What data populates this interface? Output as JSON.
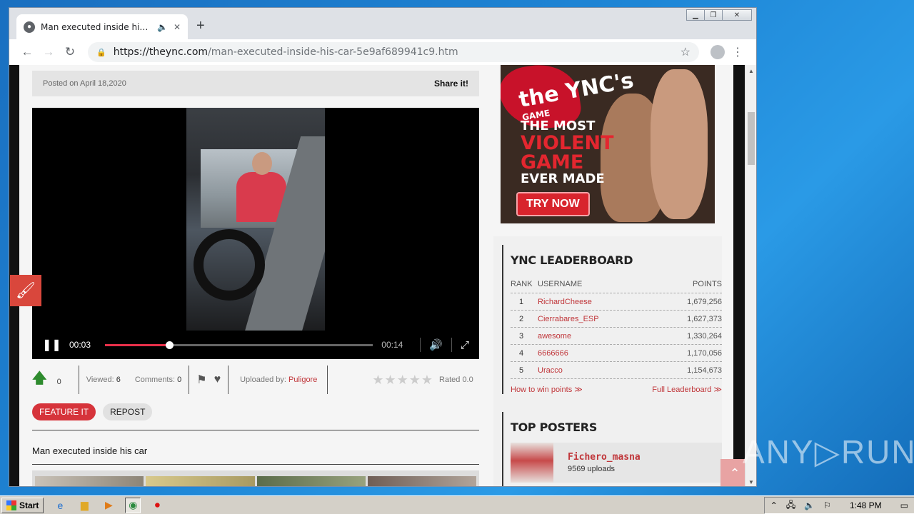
{
  "browser": {
    "tab_title": "Man executed inside his car | th",
    "url_host": "https://theync.com",
    "url_path": "/man-executed-inside-his-car-5e9af689941c9.htm"
  },
  "post": {
    "posted": "Posted on April 18,2020",
    "share": "Share it!"
  },
  "player": {
    "current_time": "00:03",
    "duration": "00:14",
    "progress": 0.23
  },
  "stats": {
    "upvotes": "0",
    "viewed_label": "Viewed:",
    "viewed": "6",
    "comments_label": "Comments:",
    "comments": "0",
    "uploaded_label": "Uploaded by:",
    "uploader": "Puligore",
    "rated": "Rated 0.0"
  },
  "buttons": {
    "feature": "FEATURE IT",
    "repost": "REPOST"
  },
  "description": "Man executed inside his car",
  "ad": {
    "logo": "the YNC's",
    "logo_sub": "GAME",
    "line1": "THE MOST",
    "line2": "VIOLENT",
    "line3": "GAME",
    "line4": "EVER MADE",
    "cta": "TRY NOW"
  },
  "leaderboard": {
    "title": "YNC LEADERBOARD",
    "col_rank": "RANK",
    "col_user": "USERNAME",
    "col_points": "POINTS",
    "rows": [
      {
        "rank": "1",
        "user": "RichardCheese",
        "points": "1,679,256"
      },
      {
        "rank": "2",
        "user": "Cierrabares_ESP",
        "points": "1,627,373"
      },
      {
        "rank": "3",
        "user": "awesome",
        "points": "1,330,264"
      },
      {
        "rank": "4",
        "user": "6666666",
        "points": "1,170,056"
      },
      {
        "rank": "5",
        "user": "Uracco",
        "points": "1,154,673"
      }
    ],
    "how_to": "How to win points ≫",
    "full": "Full Leaderboard ≫"
  },
  "top_posters": {
    "title": "TOP POSTERS",
    "name": "Fichero_masna",
    "uploads": "9569 uploads"
  },
  "watermark": "ANY▷RUN",
  "taskbar": {
    "start": "Start",
    "clock": "1:48 PM"
  }
}
